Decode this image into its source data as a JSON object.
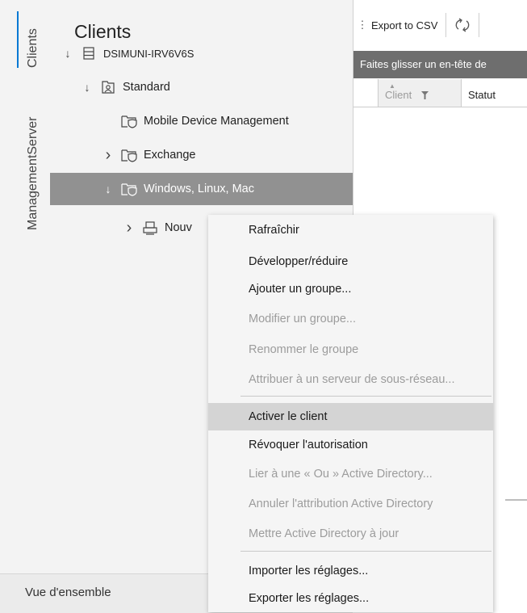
{
  "vertical_tabs": {
    "clients": "Clients",
    "management_server": "ManagementServer"
  },
  "tree": {
    "title": "Clients",
    "nodes": [
      {
        "label": "DSIMUNI-IRV6V6S",
        "arrow": "↓",
        "icon": "server-icon"
      },
      {
        "label": "Standard",
        "arrow": "↓",
        "icon": "group-icon"
      },
      {
        "label": "Mobile Device Management",
        "arrow": "",
        "icon": "folder-shield-icon"
      },
      {
        "label": "Exchange",
        "arrow": "›",
        "icon": "folder-shield-icon"
      },
      {
        "label": "Windows, Linux, Mac",
        "arrow": "↓",
        "icon": "folder-shield-icon"
      },
      {
        "label": "Nouv",
        "arrow": "›",
        "icon": "computers-icon"
      }
    ]
  },
  "toolbar": {
    "export_label": "Export to CSV",
    "refresh_icon": "refresh-icon"
  },
  "grid": {
    "group_hint": "Faites glisser un en-tête de",
    "columns": [
      "Client",
      "Statut"
    ]
  },
  "bottom_nav": {
    "label": "Vue d'ensemble"
  },
  "context_menu": {
    "items": [
      {
        "label": "Rafraîchir",
        "enabled": true
      },
      {
        "label": "Développer/réduire",
        "enabled": true
      },
      {
        "label": "Ajouter un groupe...",
        "enabled": true
      },
      {
        "label": "Modifier un groupe...",
        "enabled": false
      },
      {
        "label": "Renommer le groupe",
        "enabled": false
      },
      {
        "label": "Attribuer à un serveur de sous-réseau...",
        "enabled": false
      },
      {
        "label": "Activer le client",
        "enabled": true,
        "highlighted": true
      },
      {
        "label": "Révoquer l'autorisation",
        "enabled": true
      },
      {
        "label": "Lier à une « Ou » Active Directory...",
        "enabled": false
      },
      {
        "label": "Annuler l'attribution Active Directory",
        "enabled": false
      },
      {
        "label": "Mettre Active Directory à jour",
        "enabled": false
      },
      {
        "label": "Importer les réglages...",
        "enabled": true
      },
      {
        "label": "Exporter les réglages...",
        "enabled": true
      }
    ]
  },
  "colors": {
    "accent": "#0078d4",
    "selected_row": "#919191",
    "group_bar": "#6e6e6e",
    "menu_hover": "#d4d4d4"
  }
}
